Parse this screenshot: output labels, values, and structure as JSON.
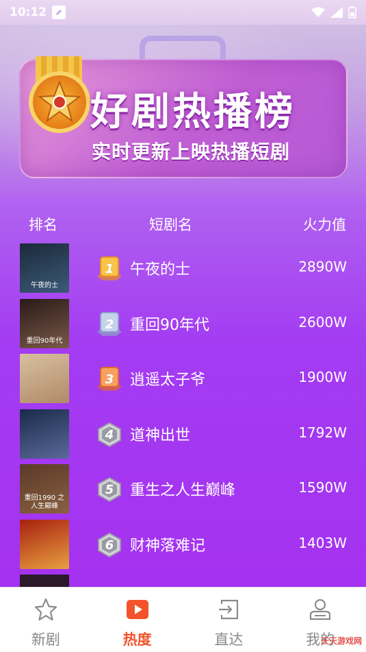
{
  "status_bar": {
    "time": "10:12"
  },
  "banner": {
    "title": "好剧热播榜",
    "subtitle": "实时更新上映热播短剧"
  },
  "table_header": {
    "rank": "排名",
    "name": "短剧名",
    "heat": "火力值"
  },
  "rows": [
    {
      "rank": "1",
      "title": "午夜的士",
      "heat": "2890W",
      "badge": "gold",
      "thumb_text": "午夜的士",
      "thumb_colors": [
        "#1b2a3a",
        "#3c5a78"
      ]
    },
    {
      "rank": "2",
      "title": "重回90年代",
      "heat": "2600W",
      "badge": "silver",
      "thumb_text": "重回90年代",
      "thumb_colors": [
        "#2a1a18",
        "#7a5a48"
      ]
    },
    {
      "rank": "3",
      "title": "逍遥太子爷",
      "heat": "1900W",
      "badge": "bronze",
      "thumb_text": "",
      "thumb_colors": [
        "#d8c0a0",
        "#b08a68"
      ]
    },
    {
      "rank": "4",
      "title": "道神出世",
      "heat": "1792W",
      "badge": "gray",
      "thumb_text": "",
      "thumb_colors": [
        "#1a2a4a",
        "#5a6a9a"
      ]
    },
    {
      "rank": "5",
      "title": "重生之人生巅峰",
      "heat": "1590W",
      "badge": "gray",
      "thumb_text": "重回1990 之人生巅峰",
      "thumb_colors": [
        "#5a3a28",
        "#8a6040"
      ]
    },
    {
      "rank": "6",
      "title": "财神落难记",
      "heat": "1403W",
      "badge": "gray",
      "thumb_text": "",
      "thumb_colors": [
        "#a82010",
        "#e8a040"
      ]
    }
  ],
  "bottom_nav": [
    {
      "label": "新剧",
      "icon": "star-icon",
      "active": false
    },
    {
      "label": "热度",
      "icon": "play-icon",
      "active": true
    },
    {
      "label": "直达",
      "icon": "enter-icon",
      "active": false
    },
    {
      "label": "我的",
      "icon": "user-icon",
      "active": false
    }
  ],
  "watermark": "天天游戏网",
  "colors": {
    "accent": "#f2532a",
    "gold": "#f5a93a",
    "silver": "#a9b8d8",
    "bronze": "#f08a48",
    "gray": "#b8b8c0"
  }
}
